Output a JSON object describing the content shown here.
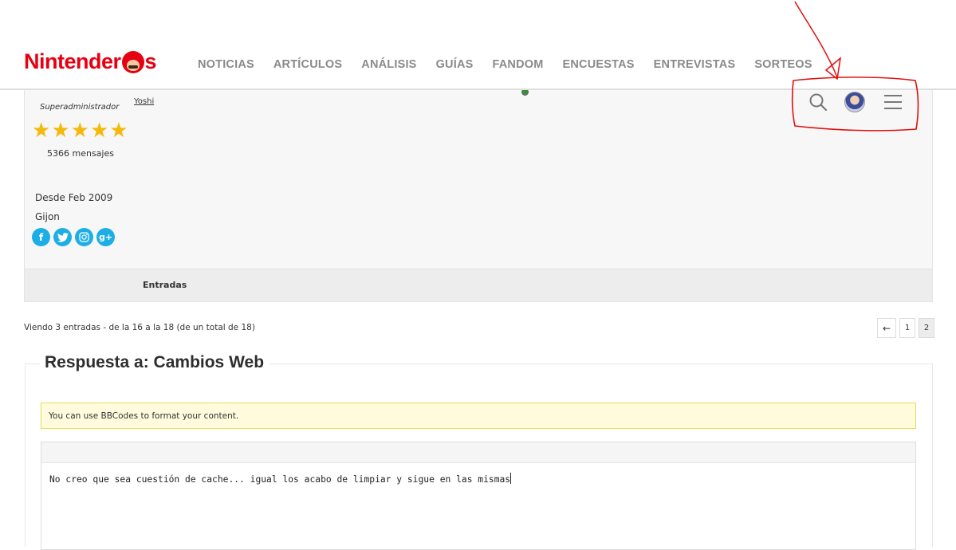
{
  "header": {
    "logo": "Nintenderos",
    "nav": [
      "NOTICIAS",
      "ARTÍCULOS",
      "ANÁLISIS",
      "GUÍAS",
      "FANDOM",
      "ENCUESTAS",
      "ENTREVISTAS",
      "SORTEOS"
    ]
  },
  "author": {
    "role": "Superadministrador",
    "link": "Yoshi",
    "rating_stars": 5,
    "messages": "5366 mensajes",
    "since": "Desde Feb 2009",
    "location": "Gijon",
    "socials": [
      "facebook-icon",
      "twitter-icon",
      "instagram-icon",
      "google-plus-icon"
    ]
  },
  "entries_label": "Entradas",
  "pagination": {
    "viewing": "Viendo 3 entradas - de la 16 a la 18 (de un total de 18)",
    "prev": "←",
    "pages": [
      "1",
      "2"
    ],
    "current_page": "2"
  },
  "reply": {
    "title": "Respuesta a: Cambios Web",
    "notice": "You can use BBCodes to format your content.",
    "content": "No creo que sea cuestión de cache... igual los acabo de limpiar y sigue en las mismas"
  },
  "colors": {
    "brand": "#e60012",
    "star": "#f5b90b",
    "social": "#1daee6",
    "annotation": "#e01010"
  }
}
